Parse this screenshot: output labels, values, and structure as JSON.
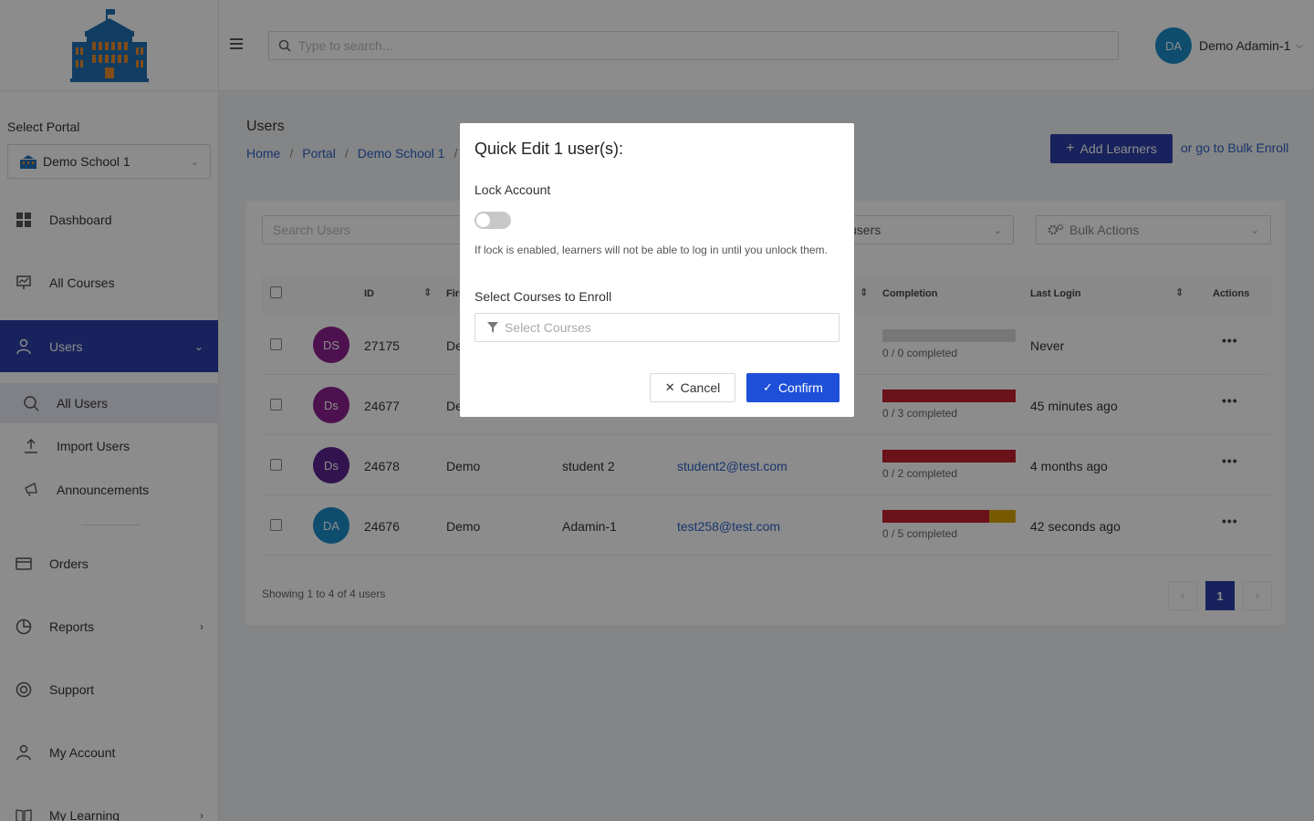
{
  "header": {
    "search_placeholder": "Type to search...",
    "user_initials": "DA",
    "user_name": "Demo Adamin-1"
  },
  "sidebar": {
    "portal_label": "Select Portal",
    "portal_value": "Demo School 1",
    "items": [
      {
        "label": "Dashboard",
        "icon": "dashboard-icon"
      },
      {
        "label": "All Courses",
        "icon": "courses-icon"
      },
      {
        "label": "Users",
        "icon": "user-icon"
      },
      {
        "label": "Orders",
        "icon": "orders-icon"
      },
      {
        "label": "Reports",
        "icon": "reports-icon"
      },
      {
        "label": "Support",
        "icon": "support-icon"
      },
      {
        "label": "My Account",
        "icon": "account-icon"
      },
      {
        "label": "My Learning",
        "icon": "learning-icon"
      }
    ],
    "sub_items": [
      {
        "label": "All Users",
        "icon": "search-icon"
      },
      {
        "label": "Import Users",
        "icon": "upload-icon"
      },
      {
        "label": "Announcements",
        "icon": "megaphone-icon"
      }
    ]
  },
  "main": {
    "title": "Users",
    "breadcrumb": [
      "Home",
      "Portal",
      "Demo School 1"
    ],
    "add_button": "Add Learners",
    "bulk_link": "or go to Bulk Enroll",
    "search_placeholder": "Search Users",
    "users_filter": "users",
    "bulk_actions": "Bulk Actions",
    "columns": {
      "id": "ID",
      "first": "Firs",
      "completion": "Completion",
      "last_login": "Last Login",
      "actions": "Actions"
    },
    "rows": [
      {
        "initials": "DS",
        "color": "#8b1f8f",
        "id": "27175",
        "first": "De",
        "last": "",
        "email": "",
        "completed": 0,
        "red": 0,
        "yellow": 0,
        "completion_text": "0 / 0 completed",
        "last_login": "Never"
      },
      {
        "initials": "Ds",
        "color": "#8b1f8f",
        "id": "24677",
        "first": "De",
        "last": "",
        "email": "",
        "completed": 3,
        "red": 1.0,
        "yellow": 0,
        "completion_text": "0 / 3 completed",
        "last_login": "45 minutes ago"
      },
      {
        "initials": "Ds",
        "color": "#5b2390",
        "id": "24678",
        "first": "Demo",
        "last": "student 2",
        "email": "student2@test.com",
        "completed": 2,
        "red": 1.0,
        "yellow": 0,
        "completion_text": "0 / 2 completed",
        "last_login": "4 months ago"
      },
      {
        "initials": "DA",
        "color": "#1a8dc9",
        "id": "24676",
        "first": "Demo",
        "last": "Adamin-1",
        "email": "test258@test.com",
        "completed": 5,
        "red": 0.8,
        "yellow": 0.2,
        "completion_text": "0 / 5 completed",
        "last_login": "42 seconds ago"
      }
    ],
    "showing": "Showing 1 to 4 of 4 users",
    "current_page": "1"
  },
  "modal": {
    "title": "Quick Edit 1 user(s):",
    "lock_label": "Lock Account",
    "lock_help": "If lock is enabled, learners will not be able to log in until you unlock them.",
    "courses_label": "Select Courses to Enroll",
    "courses_placeholder": "Select Courses",
    "cancel": "Cancel",
    "confirm": "Confirm"
  }
}
